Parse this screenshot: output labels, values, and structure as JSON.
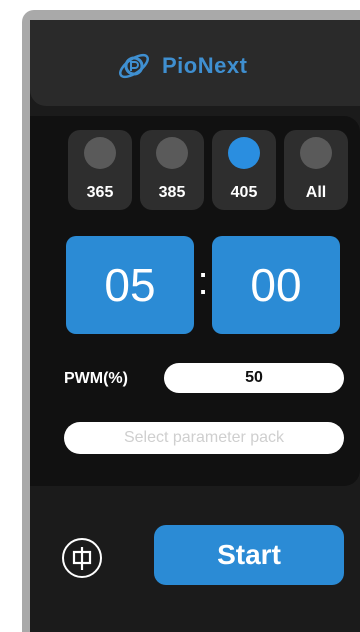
{
  "brand": {
    "name": "PioNext",
    "accent": "#3f8fd0"
  },
  "wavelengths": [
    {
      "label": "365",
      "selected": false
    },
    {
      "label": "385",
      "selected": false
    },
    {
      "label": "405",
      "selected": true
    },
    {
      "label": "All",
      "selected": false
    }
  ],
  "timer": {
    "minutes": "05",
    "separator": ":",
    "seconds": "00"
  },
  "pwm": {
    "label": "PWM(%)",
    "value": "50"
  },
  "parameter_pack": {
    "placeholder": "Select parameter pack"
  },
  "actions": {
    "language_icon": "zhong-character-icon",
    "start_label": "Start"
  },
  "colors": {
    "button_blue": "#2b8bd5",
    "selected_dot": "#2a8ee0",
    "inactive_dot": "#5a5a5a"
  }
}
